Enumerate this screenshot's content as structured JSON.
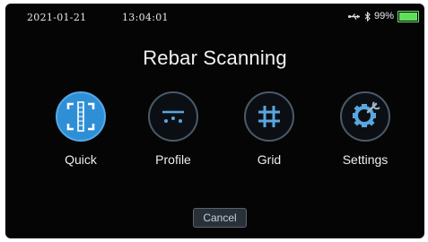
{
  "status": {
    "date": "2021-01-21",
    "time": "13:04:01",
    "battery_text": "99%",
    "battery_level": 0.99
  },
  "title": "Rebar Scanning",
  "menu": {
    "items": [
      {
        "label": "Quick",
        "icon": "quick-scan-icon",
        "selected": true
      },
      {
        "label": "Profile",
        "icon": "profile-icon",
        "selected": false
      },
      {
        "label": "Grid",
        "icon": "grid-icon",
        "selected": false
      },
      {
        "label": "Settings",
        "icon": "settings-gear-icon",
        "selected": false
      }
    ]
  },
  "cancel_label": "Cancel",
  "colors": {
    "background": "#050505",
    "accent_blue": "#2f8fd6",
    "icon_blue": "#4aa0e0",
    "battery_green": "#5ee05a"
  }
}
